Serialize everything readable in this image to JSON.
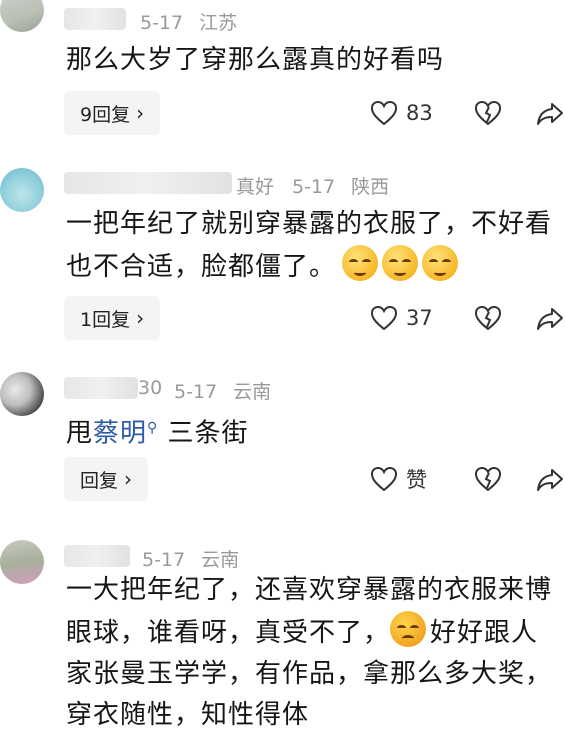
{
  "comments": [
    {
      "name_fragment": "",
      "date": "5-17",
      "location": "江苏",
      "text": "那么大岁了穿那么露真的好看吗",
      "reply_label": "9回复",
      "like_count": "83"
    },
    {
      "name_fragment": "真好",
      "date": "5-17",
      "location": "陕西",
      "text": "一把年纪了就别穿暴露的衣服了，不好看也不合适，脸都僵了。",
      "reply_label": "1回复",
      "like_count": "37"
    },
    {
      "name_fragment": "30",
      "date": "5-17",
      "location": "云南",
      "text_prefix": "甩",
      "text_link": "蔡明",
      "text_suffix": " 三条街",
      "reply_label": "回复",
      "like_count": "赞"
    },
    {
      "name_fragment": "",
      "date": "5-17",
      "location": "云南",
      "text_a": "一大把年纪了，还喜欢穿暴露的衣服来博眼球，谁看呀，真受不了，",
      "text_b": "好好跟人家张曼玉学学，有作品，拿那么多大奖，穿衣随性，知性得体"
    }
  ],
  "icons": {
    "like": "heart-outline-icon",
    "dislike": "broken-heart-icon",
    "share": "share-arrow-icon",
    "chevron": "chevron-right-icon",
    "search": "search-icon"
  },
  "colors": {
    "meta": "#9a9a9a",
    "link": "#2f5aa8",
    "reply_bg": "#f4f4f4"
  }
}
